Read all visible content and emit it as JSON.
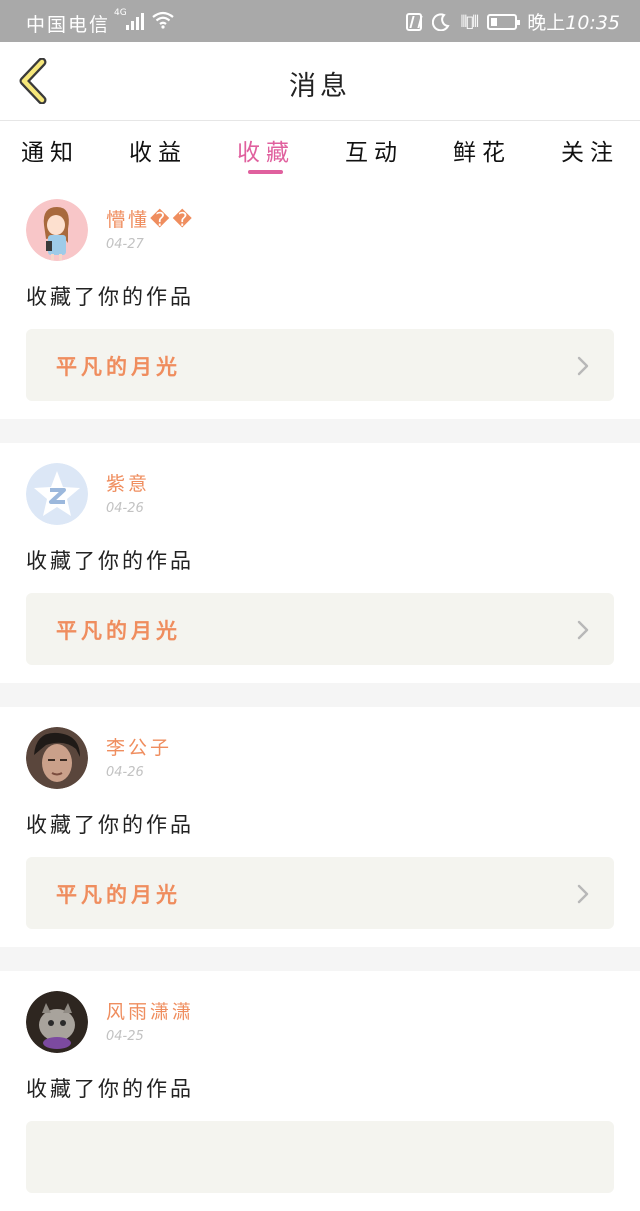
{
  "status_bar": {
    "carrier": "中国电信",
    "network": "4G",
    "time_prefix": "晚上",
    "time": "10:35"
  },
  "header": {
    "title": "消息",
    "back_icon": "chevron-left-icon"
  },
  "tabs": [
    {
      "label": "通知",
      "active": false
    },
    {
      "label": "收益",
      "active": false
    },
    {
      "label": "收藏",
      "active": true
    },
    {
      "label": "互动",
      "active": false
    },
    {
      "label": "鲜花",
      "active": false
    },
    {
      "label": "关注",
      "active": false
    }
  ],
  "colors": {
    "accent": "#e0609e",
    "username": "#ef8d5e",
    "status_bar": "#a9a9a9",
    "work_bg": "#f4f4ef"
  },
  "feed": [
    {
      "username": "懵懂��",
      "date": "04-27",
      "action": "收藏了你的作品",
      "work_title": "平凡的月光",
      "avatar": "cartoon-girl-avatar"
    },
    {
      "username": "紫意",
      "date": "04-26",
      "action": "收藏了你的作品",
      "work_title": "平凡的月光",
      "avatar": "qzone-default-avatar"
    },
    {
      "username": "李公子",
      "date": "04-26",
      "action": "收藏了你的作品",
      "work_title": "平凡的月光",
      "avatar": "photo-man-avatar"
    },
    {
      "username": "风雨潇潇",
      "date": "04-25",
      "action": "收藏了你的作品",
      "work_title": "",
      "avatar": "photo-cat-avatar"
    }
  ]
}
